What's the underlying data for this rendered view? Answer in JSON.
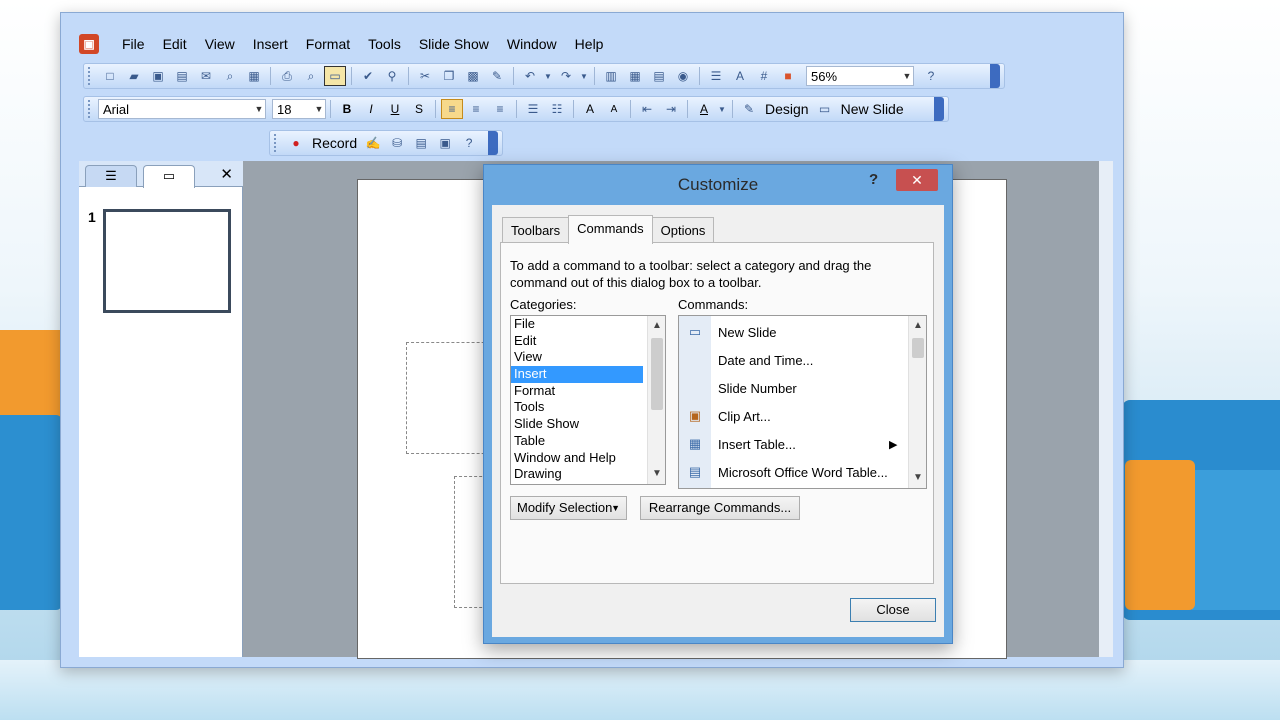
{
  "app": {
    "menu": [
      "File",
      "Edit",
      "View",
      "Insert",
      "Format",
      "Tools",
      "Slide Show",
      "Window",
      "Help"
    ],
    "zoom": "56%",
    "font_name": "Arial",
    "font_size": "18",
    "design_label": "Design",
    "new_slide_label": "New Slide",
    "record_label": "Record"
  },
  "slides_pane": {
    "slide_number": "1"
  },
  "dialog": {
    "title": "Customize",
    "help_glyph": "?",
    "close_glyph": "✕",
    "tabs": [
      "Toolbars",
      "Commands",
      "Options"
    ],
    "active_tab": "Commands",
    "instructions": "To add a command to a toolbar: select a category and drag the command out of this dialog box to a toolbar.",
    "categories_label": "Categories:",
    "commands_label": "Commands:",
    "categories": [
      "File",
      "Edit",
      "View",
      "Insert",
      "Format",
      "Tools",
      "Slide Show",
      "Table",
      "Window and Help",
      "Drawing"
    ],
    "selected_category": "Insert",
    "commands": [
      "New Slide",
      "Date and Time...",
      "Slide Number",
      "Clip Art...",
      "Insert Table...",
      "Microsoft Office Word Table..."
    ],
    "modify_selection_label": "Modify Selection",
    "rearrange_label": "Rearrange Commands...",
    "close_label": "Close"
  }
}
